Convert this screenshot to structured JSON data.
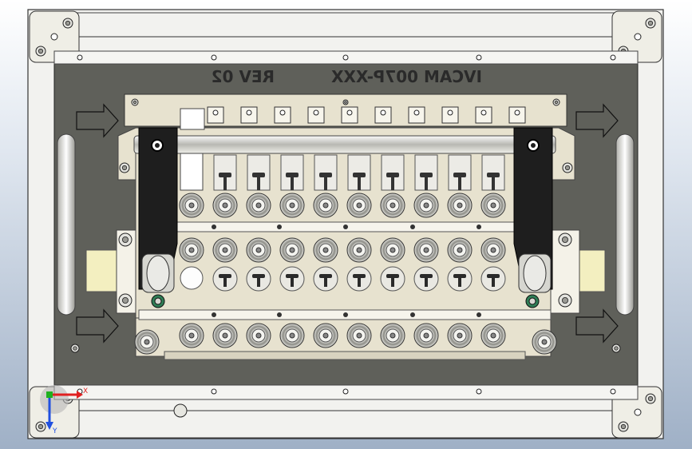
{
  "viewport": {
    "background_top": "#ffffff",
    "background_bottom": "#9fb0c6"
  },
  "model": {
    "plate_engraving_part": "IVCAM 007P-XXX",
    "plate_engraving_rev": "REV 02",
    "plate_color": "#5f605a",
    "frame_color": "#f2f2ef",
    "fixture_color": "#e7e2cf",
    "bracket_color": "#1e1e1e",
    "handle_color": "#dcdcd8",
    "pad_color": "#f3efc0",
    "connector_columns": 10
  },
  "triad": {
    "x_label": "X",
    "y_label": "Y",
    "x_color": "#e02020",
    "y_color": "#2050e0",
    "z_color": "#20b020"
  }
}
